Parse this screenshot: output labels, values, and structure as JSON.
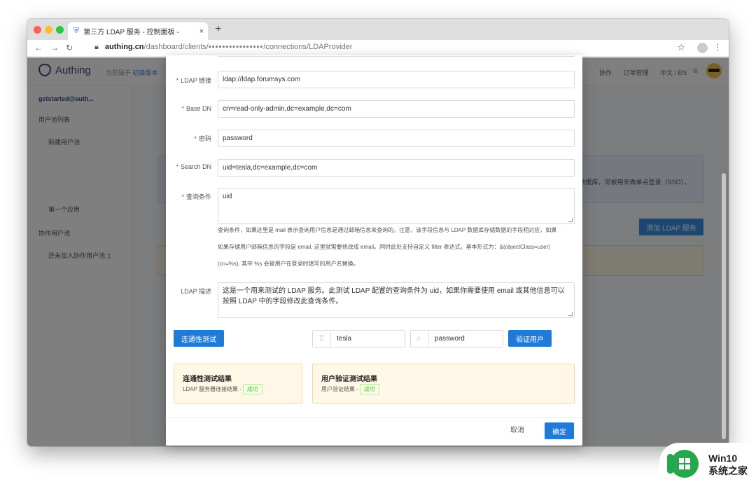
{
  "browser": {
    "tab_title": "第三方 LDAP 服务 - 控制面板 -",
    "tab_close": "×",
    "new_tab": "+",
    "url_host": "authing.cn",
    "url_path": "/dashboard/clients/",
    "url_tail": "/connections/LDAProvider"
  },
  "app": {
    "brand": "Authing",
    "belong_prefix": "当前属于",
    "belong_link": "初级版本",
    "header_links": [
      "协作",
      "订单管理",
      "中文 / EN"
    ],
    "sidebar": {
      "user": "getstarted@auth...",
      "pool_list": "用户池列表",
      "new_pool": "新建用户池",
      "first_app": "第一个应用",
      "collab_pool": "协作用户池",
      "collab_empty": "还未加入协作用户池 :)"
    },
    "info_text": "的数据库，常被用来做单点登录（SSO），",
    "add_button": "添加 LDAP 服务"
  },
  "form": {
    "ldap_link_label": "LDAP 链接",
    "ldap_link_value": "ldap://ldap.forumsys.com",
    "base_dn_label": "Base DN",
    "base_dn_value": "cn=read-only-admin,dc=example,dc=com",
    "password_label": "密码",
    "password_value": "password",
    "search_dn_label": "Search DN",
    "search_dn_value": "uid=tesla,dc=example,dc=com",
    "query_label": "查询条件",
    "query_value": "uid",
    "query_help_1": "查询条件，如果这里是 mail 表示查询用户信息是通过邮箱信息来查询的。注意，该字段信息与 LDAP 数据库存储数据的字段相对应，如果",
    "query_help_2": "如果存储用户邮箱信息的字段是 email, 这里就需要修改成 email。同时此处支持自定义 filter 表达式，基本形式为：&(objectClass=user)",
    "query_help_3": "(cn=%s), 其中 %s 会被用户在登录时填写的用户名替换。",
    "desc_label": "LDAP 描述",
    "desc_value": "这是一个用来测试的 LDAP 服务。此测试 LDAP 配置的查询条件为 uid，如果你需要使用 email 或其他信息可以按照 LDAP 中的字段修改此查询条件。",
    "test_button": "连通性测试",
    "test_user": "tesla",
    "test_password": "password",
    "verify_button": "验证用户"
  },
  "results": {
    "conn_title": "连通性测试结果",
    "conn_line": "LDAP 服务器连接结果 -",
    "conn_status": "成功",
    "user_title": "用户验证测试结果",
    "user_line": "用户验证结果 -",
    "user_status": "成功"
  },
  "footer": {
    "cancel": "取消",
    "ok": "确定"
  },
  "watermark": {
    "line1": "Win10",
    "line2": "系统之家"
  },
  "colors": {
    "primary": "#1f7ad8",
    "success": "#52c41a",
    "required": "#f5222d"
  }
}
